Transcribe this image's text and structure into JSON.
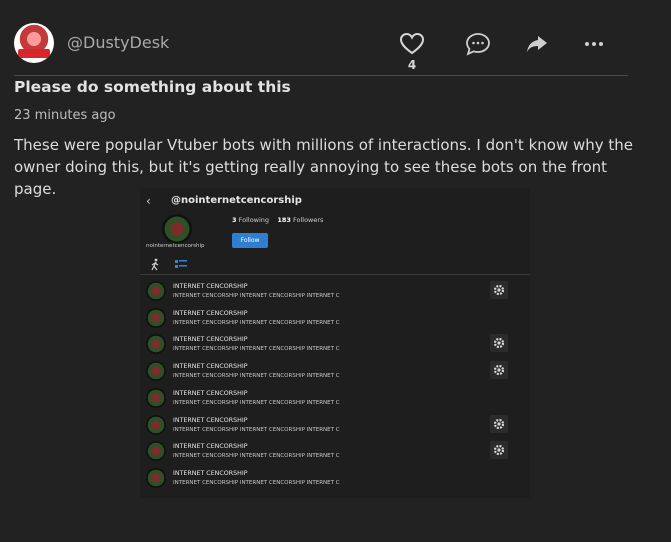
{
  "post": {
    "username": "@DustyDesk",
    "avatar_label": "WEBSOCK",
    "like_count": "4",
    "title": "Please do something about this",
    "time": "23 minutes ago",
    "body": "These were popular Vtuber bots with millions of interactions. I don't know why the owner doing this, but it's getting really annoying to see these bots on the front page."
  },
  "screenshot": {
    "handle": "@nointernetcencorship",
    "profile_name": "nointernetcencorship",
    "following_count": "3",
    "following_label": "Following",
    "followers_count": "183",
    "followers_label": "Followers",
    "follow_label": "Follow",
    "items": [
      {
        "title": "INTERNET CENCORSHIP",
        "subtitle": "INTERNET CENCORSHIP INTERNET CENCORSHIP INTERNET C",
        "gear": true
      },
      {
        "title": "INTERNET CENCORSHIP",
        "subtitle": "INTERNET CENCORSHIP INTERNET CENCORSHIP INTERNET C",
        "gear": false
      },
      {
        "title": "INTERNET CENCORSHIP",
        "subtitle": "INTERNET CENCORSHIP INTERNET CENCORSHIP INTERNET C",
        "gear": true
      },
      {
        "title": "INTERNET CENCORSHIP",
        "subtitle": "INTERNET CENCORSHIP INTERNET CENCORSHIP INTERNET C",
        "gear": true
      },
      {
        "title": "INTERNET CENCORSHIP",
        "subtitle": "INTERNET CENCORSHIP INTERNET CENCORSHIP INTERNET C",
        "gear": false
      },
      {
        "title": "INTERNET CENCORSHIP",
        "subtitle": "INTERNET CENCORSHIP INTERNET CENCORSHIP INTERNET C",
        "gear": true
      },
      {
        "title": "INTERNET CENCORSHIP",
        "subtitle": "INTERNET CENCORSHIP INTERNET CENCORSHIP INTERNET C",
        "gear": true
      },
      {
        "title": "INTERNET CENCORSHIP",
        "subtitle": "INTERNET CENCORSHIP INTERNET CENCORSHIP INTERNET C",
        "gear": false
      }
    ]
  },
  "icons": {
    "like": "heart-icon",
    "comment": "comment-icon",
    "share": "share-icon",
    "more": "more-icon"
  },
  "colors": {
    "background": "#222222",
    "follow_button": "#2f7fd0"
  }
}
